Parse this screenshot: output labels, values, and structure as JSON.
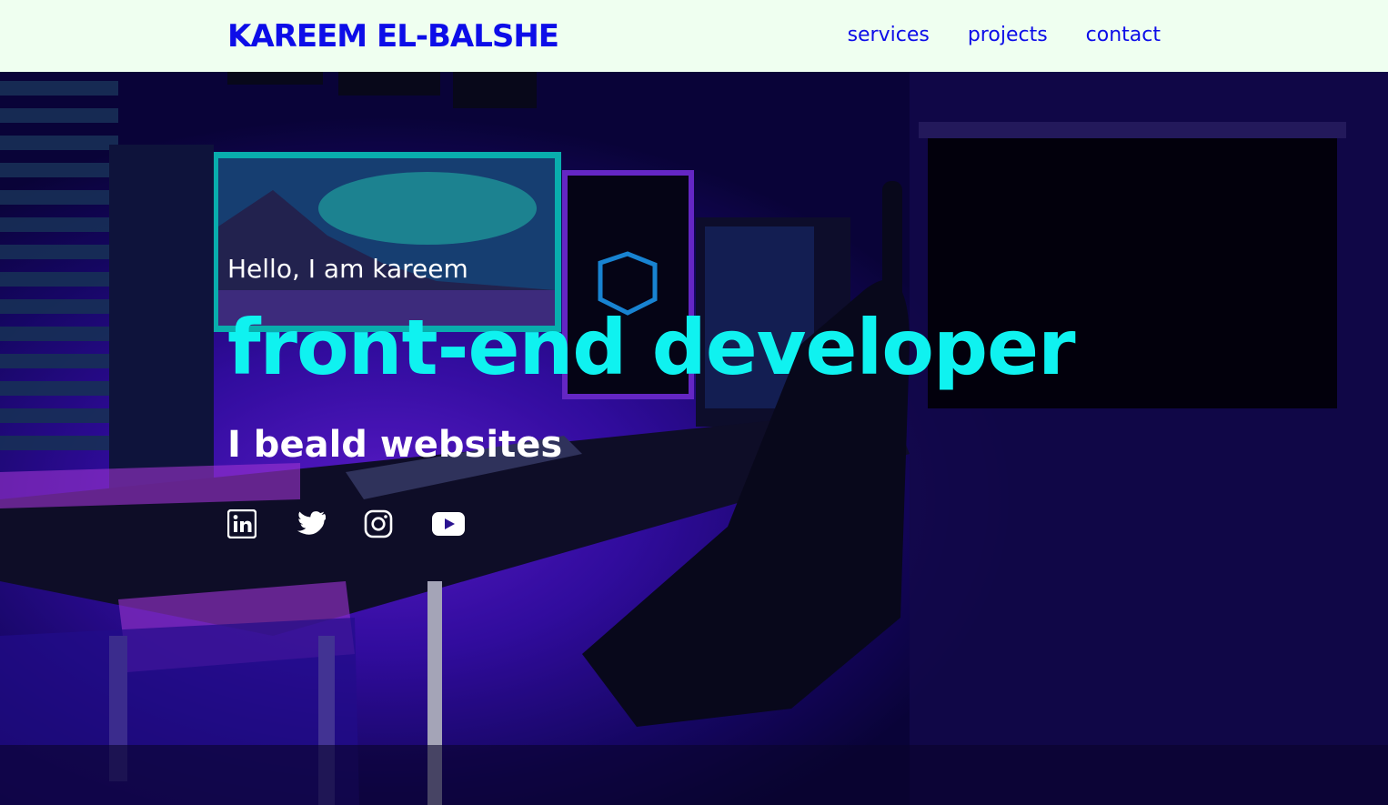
{
  "header": {
    "brand": "KAREEM EL-BALSHE",
    "nav": [
      "services",
      "projects",
      "contact"
    ]
  },
  "hero": {
    "greeting": "Hello, I am kareem",
    "role": "front-end developer",
    "tagline": "I beald websites",
    "social_icons": [
      "linkedin-icon",
      "twitter-icon",
      "instagram-icon",
      "youtube-icon"
    ]
  },
  "colors": {
    "header_bg": "#effff0",
    "brand_blue": "#0d0de8",
    "accent_cyan": "#0ff2f0",
    "hero_purple": "#3c0fc0"
  }
}
